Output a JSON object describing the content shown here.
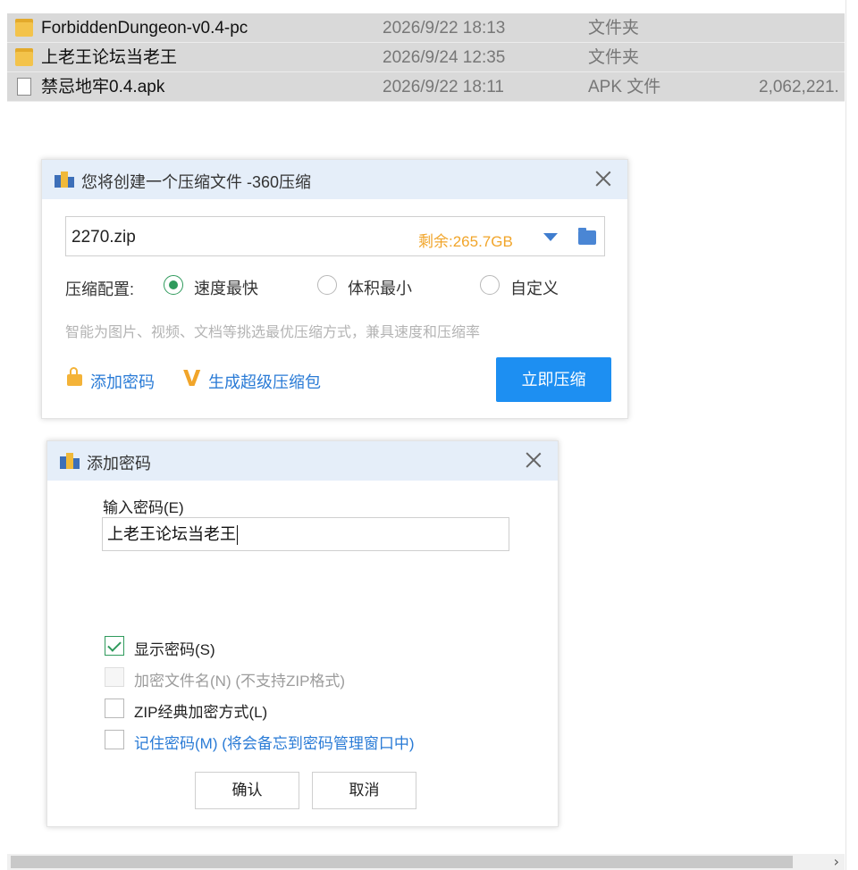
{
  "files": [
    {
      "icon": "folder-icon",
      "name": "ForbiddenDungeon-v0.4-pc",
      "date": "2026/9/22 18:13",
      "type": "文件夹",
      "size": ""
    },
    {
      "icon": "folder-icon",
      "name": "上老王论坛当老王",
      "date": "2026/9/24 12:35",
      "type": "文件夹",
      "size": ""
    },
    {
      "icon": "file-icon",
      "name": "禁忌地牢0.4.apk",
      "date": "2026/9/22 18:11",
      "type": "APK 文件",
      "size": "2,062,221."
    }
  ],
  "compress_dialog": {
    "title": "您将创建一个压缩文件 -360压缩",
    "filename": "2270.zip",
    "free_space": "剩余:265.7GB",
    "config_label": "压缩配置:",
    "options": [
      {
        "label": "速度最快",
        "checked": true
      },
      {
        "label": "体积最小",
        "checked": false
      },
      {
        "label": "自定义",
        "checked": false
      }
    ],
    "hint": "智能为图片、视频、文档等挑选最优压缩方式，兼具速度和压缩率",
    "add_password": "添加密码",
    "super_package": "生成超级压缩包",
    "compress_now": "立即压缩"
  },
  "password_dialog": {
    "title": "添加密码",
    "input_label": "输入密码(E)",
    "password_value": "上老王论坛当老王",
    "checkboxes": [
      {
        "label": "显示密码(S)",
        "checked": true,
        "disabled": false,
        "style": "normal"
      },
      {
        "label": "加密文件名(N) (不支持ZIP格式)",
        "checked": false,
        "disabled": true,
        "style": "muted"
      },
      {
        "label": "ZIP经典加密方式(L)",
        "checked": false,
        "disabled": false,
        "style": "normal"
      },
      {
        "label": "记住密码(M) (将会备忘到密码管理窗口中)",
        "checked": false,
        "disabled": false,
        "style": "link"
      }
    ],
    "ok": "确认",
    "cancel": "取消"
  },
  "scrollbar": {
    "arrow": "›"
  }
}
